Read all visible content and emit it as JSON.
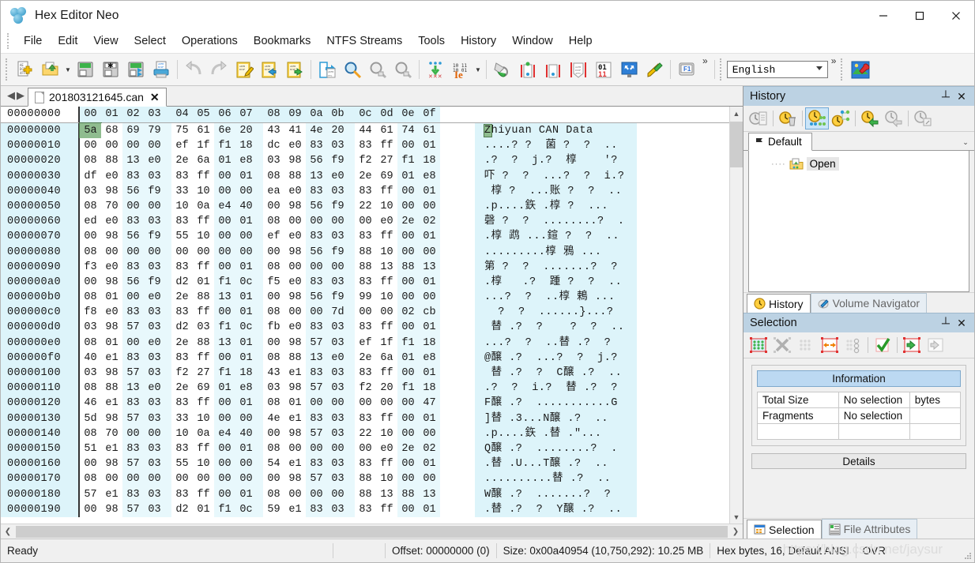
{
  "window": {
    "title": "Hex Editor Neo",
    "logo_icon": "hex-neo-logo-icon",
    "minimize_label": "–",
    "maximize_label": "□",
    "close_label": "✕"
  },
  "menubar": {
    "items": [
      {
        "label": "File"
      },
      {
        "label": "Edit"
      },
      {
        "label": "View"
      },
      {
        "label": "Select"
      },
      {
        "label": "Operations"
      },
      {
        "label": "Bookmarks"
      },
      {
        "label": "NTFS Streams"
      },
      {
        "label": "Tools"
      },
      {
        "label": "History"
      },
      {
        "label": "Window"
      },
      {
        "label": "Help"
      }
    ]
  },
  "toolbar": {
    "buttons": [
      {
        "name": "new-file",
        "icon": "new-document-icon"
      },
      {
        "name": "open-file",
        "icon": "open-folder-icon"
      },
      {
        "name": "open-dropdown",
        "icon": "chevron-down-icon"
      },
      {
        "name": "save",
        "icon": "floppy-save-icon"
      },
      {
        "name": "save-as",
        "icon": "floppy-save-as-icon"
      },
      {
        "name": "save-all",
        "icon": "floppy-save-all-icon"
      },
      {
        "name": "print",
        "icon": "printer-icon"
      },
      {
        "name": "undo",
        "icon": "undo-arrow-icon"
      },
      {
        "name": "redo",
        "icon": "redo-arrow-icon"
      },
      {
        "name": "edit-clipboard",
        "icon": "clipboard-pencil-icon"
      },
      {
        "name": "cut-paste",
        "icon": "clipboard-blue-arrow-icon"
      },
      {
        "name": "copy",
        "icon": "clipboard-green-arrow-icon"
      },
      {
        "name": "export",
        "icon": "export-document-icon"
      },
      {
        "name": "find",
        "icon": "magnifier-orange-icon"
      },
      {
        "name": "find-next",
        "icon": "magnifier-gray-icon"
      },
      {
        "name": "find-prev",
        "icon": "magnifier-gray2-icon"
      },
      {
        "name": "goto",
        "icon": "green-down-arrows-icon"
      },
      {
        "name": "encoding",
        "icon": "binary-ie-icon"
      },
      {
        "name": "encoding-dropdown",
        "icon": "chevron-down-icon"
      },
      {
        "name": "fill",
        "icon": "paint-bucket-icon"
      },
      {
        "name": "insert-left",
        "icon": "bracket-left-icon"
      },
      {
        "name": "insert-right",
        "icon": "bracket-right-icon"
      },
      {
        "name": "pattern",
        "icon": "pattern-shield-icon"
      },
      {
        "name": "bits-view",
        "icon": "binary-0111-icon"
      },
      {
        "name": "fullscreen",
        "icon": "fullscreen-arrows-icon"
      },
      {
        "name": "highlighter",
        "icon": "green-pencil-icon"
      },
      {
        "name": "help",
        "icon": "f1-key-icon"
      },
      {
        "name": "overflow",
        "icon": "chevron-double-right-icon"
      },
      {
        "name": "image-tool",
        "icon": "image-wrench-icon"
      }
    ],
    "language_value": "English",
    "overflow_label": "»"
  },
  "document_tabs": {
    "prev_label": "◀",
    "next_label": "▶",
    "tabs": [
      {
        "label": "201803121645.can",
        "icon": "file-icon",
        "close_label": "✕",
        "active": true
      }
    ]
  },
  "hex_view": {
    "column_headers": [
      "00",
      "01",
      "02",
      "03",
      "04",
      "05",
      "06",
      "07",
      "08",
      "09",
      "0a",
      "0b",
      "0c",
      "0d",
      "0e",
      "0f"
    ],
    "header_address_blank": "00000000",
    "selected_offset_row": 0,
    "selected_offset_col": 0,
    "rows": [
      {
        "address": "00000000",
        "bytes": [
          "5a",
          "68",
          "69",
          "79",
          "75",
          "61",
          "6e",
          "20",
          "43",
          "41",
          "4e",
          "20",
          "44",
          "61",
          "74",
          "61"
        ],
        "ascii": "Zhiyuan CAN Data"
      },
      {
        "address": "00000010",
        "bytes": [
          "00",
          "00",
          "00",
          "00",
          "ef",
          "1f",
          "f1",
          "18",
          "dc",
          "e0",
          "83",
          "03",
          "83",
          "ff",
          "00",
          "01"
        ],
        "ascii": "....? ?  菌 ?  ?  .."
      },
      {
        "address": "00000020",
        "bytes": [
          "08",
          "88",
          "13",
          "e0",
          "2e",
          "6a",
          "01",
          "e8",
          "03",
          "98",
          "56",
          "f9",
          "f2",
          "27",
          "f1",
          "18"
        ],
        "ascii": ".?  ?  j.?  椁    '?"
      },
      {
        "address": "00000030",
        "bytes": [
          "df",
          "e0",
          "83",
          "03",
          "83",
          "ff",
          "00",
          "01",
          "08",
          "88",
          "13",
          "e0",
          "2e",
          "69",
          "01",
          "e8"
        ],
        "ascii": "吓 ?  ?  ...?  ?  i.?"
      },
      {
        "address": "00000040",
        "bytes": [
          "03",
          "98",
          "56",
          "f9",
          "33",
          "10",
          "00",
          "00",
          "ea",
          "e0",
          "83",
          "03",
          "83",
          "ff",
          "00",
          "01"
        ],
        "ascii": " 椁 ?  ...账 ?  ?  .."
      },
      {
        "address": "00000050",
        "bytes": [
          "08",
          "70",
          "00",
          "00",
          "10",
          "0a",
          "e4",
          "40",
          "00",
          "98",
          "56",
          "f9",
          "22",
          "10",
          "00",
          "00"
        ],
        "ascii": ".p....鉃 .椁 ?  ..."
      },
      {
        "address": "00000060",
        "bytes": [
          "ed",
          "e0",
          "83",
          "03",
          "83",
          "ff",
          "00",
          "01",
          "08",
          "00",
          "00",
          "00",
          "00",
          "e0",
          "2e",
          "02"
        ],
        "ascii": "磬 ?  ?  ........?  ."
      },
      {
        "address": "00000070",
        "bytes": [
          "00",
          "98",
          "56",
          "f9",
          "55",
          "10",
          "00",
          "00",
          "ef",
          "e0",
          "83",
          "03",
          "83",
          "ff",
          "00",
          "01"
        ],
        "ascii": ".椁 鹉 ...鍹 ?  ?  .."
      },
      {
        "address": "00000080",
        "bytes": [
          "08",
          "00",
          "00",
          "00",
          "00",
          "00",
          "00",
          "00",
          "00",
          "98",
          "56",
          "f9",
          "88",
          "10",
          "00",
          "00"
        ],
        "ascii": ".........椁 鴉 ..."
      },
      {
        "address": "00000090",
        "bytes": [
          "f3",
          "e0",
          "83",
          "03",
          "83",
          "ff",
          "00",
          "01",
          "08",
          "00",
          "00",
          "00",
          "88",
          "13",
          "88",
          "13"
        ],
        "ascii": "第 ?  ?  .......?  ?"
      },
      {
        "address": "000000a0",
        "bytes": [
          "00",
          "98",
          "56",
          "f9",
          "d2",
          "01",
          "f1",
          "0c",
          "f5",
          "e0",
          "83",
          "03",
          "83",
          "ff",
          "00",
          "01"
        ],
        "ascii": ".椁   .?  踵 ?  ?  .."
      },
      {
        "address": "000000b0",
        "bytes": [
          "08",
          "01",
          "00",
          "e0",
          "2e",
          "88",
          "13",
          "01",
          "00",
          "98",
          "56",
          "f9",
          "99",
          "10",
          "00",
          "00"
        ],
        "ascii": "...?  ?  ..椁 鵣 ..."
      },
      {
        "address": "000000c0",
        "bytes": [
          "f8",
          "e0",
          "83",
          "03",
          "83",
          "ff",
          "00",
          "01",
          "08",
          "00",
          "00",
          "7d",
          "00",
          "00",
          "02",
          "cb"
        ],
        "ascii": "  ?  ?  ......}...?"
      },
      {
        "address": "000000d0",
        "bytes": [
          "03",
          "98",
          "57",
          "03",
          "d2",
          "03",
          "f1",
          "0c",
          "fb",
          "e0",
          "83",
          "03",
          "83",
          "ff",
          "00",
          "01"
        ],
        "ascii": " 替 .?  ?    ?  ?  .."
      },
      {
        "address": "000000e0",
        "bytes": [
          "08",
          "01",
          "00",
          "e0",
          "2e",
          "88",
          "13",
          "01",
          "00",
          "98",
          "57",
          "03",
          "ef",
          "1f",
          "f1",
          "18"
        ],
        "ascii": "...?  ?  ..替 .?  ?"
      },
      {
        "address": "000000f0",
        "bytes": [
          "40",
          "e1",
          "83",
          "03",
          "83",
          "ff",
          "00",
          "01",
          "08",
          "88",
          "13",
          "e0",
          "2e",
          "6a",
          "01",
          "e8"
        ],
        "ascii": "@醸 .?  ...?  ?  j.?"
      },
      {
        "address": "00000100",
        "bytes": [
          "03",
          "98",
          "57",
          "03",
          "f2",
          "27",
          "f1",
          "18",
          "43",
          "e1",
          "83",
          "03",
          "83",
          "ff",
          "00",
          "01"
        ],
        "ascii": " 替 .?  ?  C醸 .?  .."
      },
      {
        "address": "00000110",
        "bytes": [
          "08",
          "88",
          "13",
          "e0",
          "2e",
          "69",
          "01",
          "e8",
          "03",
          "98",
          "57",
          "03",
          "f2",
          "20",
          "f1",
          "18"
        ],
        "ascii": ".?  ?  i.?  替 .?  ?"
      },
      {
        "address": "00000120",
        "bytes": [
          "46",
          "e1",
          "83",
          "03",
          "83",
          "ff",
          "00",
          "01",
          "08",
          "01",
          "00",
          "00",
          "00",
          "00",
          "00",
          "47"
        ],
        "ascii": "F醸 .?  ...........G"
      },
      {
        "address": "00000130",
        "bytes": [
          "5d",
          "98",
          "57",
          "03",
          "33",
          "10",
          "00",
          "00",
          "4e",
          "e1",
          "83",
          "03",
          "83",
          "ff",
          "00",
          "01"
        ],
        "ascii": "]替 .3...N醸 .?  .."
      },
      {
        "address": "00000140",
        "bytes": [
          "08",
          "70",
          "00",
          "00",
          "10",
          "0a",
          "e4",
          "40",
          "00",
          "98",
          "57",
          "03",
          "22",
          "10",
          "00",
          "00"
        ],
        "ascii": ".p....鉃 .替 .\"..."
      },
      {
        "address": "00000150",
        "bytes": [
          "51",
          "e1",
          "83",
          "03",
          "83",
          "ff",
          "00",
          "01",
          "08",
          "00",
          "00",
          "00",
          "00",
          "e0",
          "2e",
          "02"
        ],
        "ascii": "Q醸 .?  ........?  ."
      },
      {
        "address": "00000160",
        "bytes": [
          "00",
          "98",
          "57",
          "03",
          "55",
          "10",
          "00",
          "00",
          "54",
          "e1",
          "83",
          "03",
          "83",
          "ff",
          "00",
          "01"
        ],
        "ascii": ".替 .U...T醸 .?  .."
      },
      {
        "address": "00000170",
        "bytes": [
          "08",
          "00",
          "00",
          "00",
          "00",
          "00",
          "00",
          "00",
          "00",
          "98",
          "57",
          "03",
          "88",
          "10",
          "00",
          "00"
        ],
        "ascii": "..........替 .?  .."
      },
      {
        "address": "00000180",
        "bytes": [
          "57",
          "e1",
          "83",
          "03",
          "83",
          "ff",
          "00",
          "01",
          "08",
          "00",
          "00",
          "00",
          "88",
          "13",
          "88",
          "13"
        ],
        "ascii": "W醸 .?  .......?  ?"
      },
      {
        "address": "00000190",
        "bytes": [
          "00",
          "98",
          "57",
          "03",
          "d2",
          "01",
          "f1",
          "0c",
          "59",
          "e1",
          "83",
          "03",
          "83",
          "ff",
          "00",
          "01"
        ],
        "ascii": ".替 .?  ?  Y醸 .?  .."
      }
    ]
  },
  "history_panel": {
    "title": "History",
    "pin_label": "┴",
    "close_label": "✕",
    "toolbar_icons": [
      {
        "name": "history-list-icon",
        "active": false
      },
      {
        "name": "clear-history-icon",
        "active": false
      },
      {
        "name": "history-branches-icon",
        "active": true
      },
      {
        "name": "history-tree-icon",
        "active": false
      },
      {
        "name": "save-history-icon",
        "active": false
      },
      {
        "name": "load-history-icon",
        "active": false
      },
      {
        "name": "history-properties-icon",
        "active": false
      }
    ],
    "branch_tab": "Default",
    "branch_tab_icon": "pin-flag-icon",
    "branch_dropdown_label": "⌄",
    "nodes": [
      {
        "label": "Open",
        "icon": "open-folder-small-icon"
      }
    ],
    "dock_tabs": [
      {
        "label": "History",
        "icon": "clock-icon",
        "active": true
      },
      {
        "label": "Volume Navigator",
        "icon": "volume-navigator-icon",
        "active": false
      }
    ]
  },
  "selection_panel": {
    "title": "Selection",
    "pin_label": "┴",
    "close_label": "✕",
    "toolbar_icons": [
      {
        "name": "select-all-icon",
        "active": false
      },
      {
        "name": "deselect-icon",
        "active": false
      },
      {
        "name": "select-range-icon",
        "active": false
      },
      {
        "name": "move-selection-icon",
        "active": false
      },
      {
        "name": "select-pattern-icon",
        "active": false
      },
      {
        "name": "apply-selection-icon",
        "active": false
      },
      {
        "name": "import-selection-icon",
        "active": false
      },
      {
        "name": "export-selection-icon",
        "active": false
      }
    ],
    "information_header": "Information",
    "rows": [
      {
        "label": "Total Size",
        "value": "No selection",
        "unit": "bytes"
      },
      {
        "label": "Fragments",
        "value": "No selection",
        "unit": ""
      },
      {
        "label": "",
        "value": "",
        "unit": ""
      }
    ],
    "details_button": "Details",
    "dock_tabs": [
      {
        "label": "Selection",
        "icon": "selection-icon",
        "active": true
      },
      {
        "label": "File Attributes",
        "icon": "file-attributes-icon",
        "active": false
      }
    ]
  },
  "statusbar": {
    "ready": "Ready",
    "offset": "Offset: 00000000 (0)",
    "size": "Size: 0x00a40954 (10,750,292): 10.25 MB",
    "mode": "Hex bytes, 16, Default ANSI",
    "insert_mode": "OVR",
    "watermark": "https://blog.csdn.net/jaysur"
  },
  "colors": {
    "panel_title_bg": "#bcd2e3",
    "hex_address_bg": "#ddf4fa",
    "hex_alt_col_bg": "#e8f8fc",
    "selected_byte_bg": "#8fbc8f",
    "ascii_bg": "#ddf4fa",
    "accent_blue": "#cbe5f8"
  }
}
